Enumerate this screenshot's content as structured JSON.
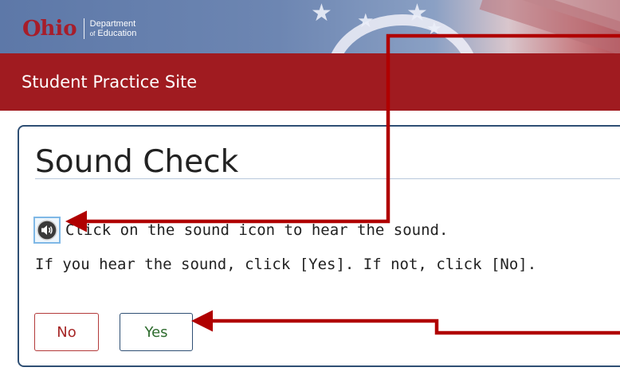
{
  "banner": {
    "logo": {
      "brand_o": "O",
      "brand_rest": "hio",
      "dept_line1": "Department",
      "dept_of": "of",
      "dept_line2": "Education"
    }
  },
  "header": {
    "site_title": "Student Practice Site"
  },
  "dialog": {
    "title": "Sound Check",
    "instruction_1": "Click on the sound icon to hear the sound.",
    "instruction_2": "If you hear the sound, click [Yes]. If not, click [No].",
    "sound_icon": "speaker-icon",
    "buttons": {
      "no_label": "No",
      "yes_label": "Yes"
    }
  },
  "colors": {
    "header_red": "#a01b20",
    "dialog_border": "#2f4f74",
    "annotation_red": "#b00000",
    "no_text": "#a62626",
    "yes_text": "#2d6b2d"
  }
}
